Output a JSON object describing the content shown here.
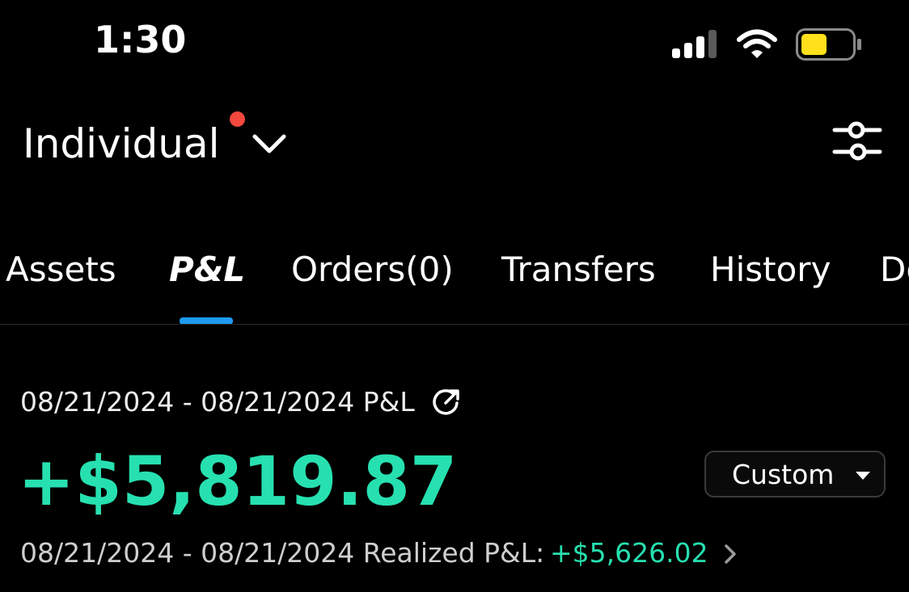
{
  "status_bar": {
    "time": "1:30",
    "icons": [
      "signal-icon",
      "wifi-icon",
      "battery-icon"
    ],
    "battery_color": "#FFE01B"
  },
  "header": {
    "account_name": "Individual",
    "notification_dot_color": "#F2483E",
    "icons": [
      "chevron-down-icon",
      "settings-sliders-icon"
    ]
  },
  "tabs": [
    {
      "label": "Assets",
      "active": false
    },
    {
      "label": "P&L",
      "active": true
    },
    {
      "label": "Orders(0)",
      "active": false
    },
    {
      "label": "Transfers",
      "active": false
    },
    {
      "label": "History",
      "active": false
    },
    {
      "label": "Do",
      "active": false
    }
  ],
  "colors": {
    "accent_tab": "#1E9BF0",
    "positive": "#27E0B0",
    "background": "#000000"
  },
  "pnl": {
    "range_title": "08/21/2024 - 08/21/2024 P&L",
    "amount": "+$5,819.87",
    "period_select": "Custom",
    "realized_label": "08/21/2024 - 08/21/2024 Realized P&L:",
    "realized_value": "+$5,626.02",
    "icons": [
      "share-icon",
      "caret-down-icon",
      "chevron-right-icon"
    ]
  }
}
